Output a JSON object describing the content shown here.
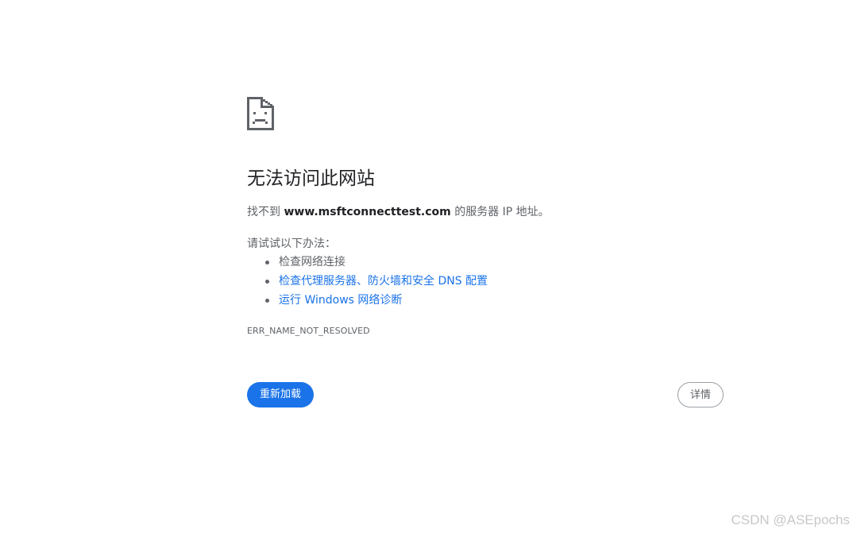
{
  "error": {
    "icon": "sad-page-icon",
    "title": "无法访问此网站",
    "subtitle_prefix": "找不到 ",
    "host": "www.msftconnecttest.com",
    "subtitle_suffix": " 的服务器 IP 地址。",
    "try_label": "请试试以下办法：",
    "suggestions": [
      {
        "label": "检查网络连接",
        "link": false
      },
      {
        "label": "检查代理服务器、防火墙和安全 DNS 配置",
        "link": true
      },
      {
        "label": "运行 Windows 网络诊断",
        "link": true
      }
    ],
    "code": "ERR_NAME_NOT_RESOLVED"
  },
  "buttons": {
    "reload_label": "重新加载",
    "details_label": "详情"
  },
  "watermark": "CSDN @ASEpochs",
  "colors": {
    "accent": "#1a73e8",
    "text_primary": "#202124",
    "text_secondary": "#5f6368",
    "icon": "#5f6368"
  }
}
